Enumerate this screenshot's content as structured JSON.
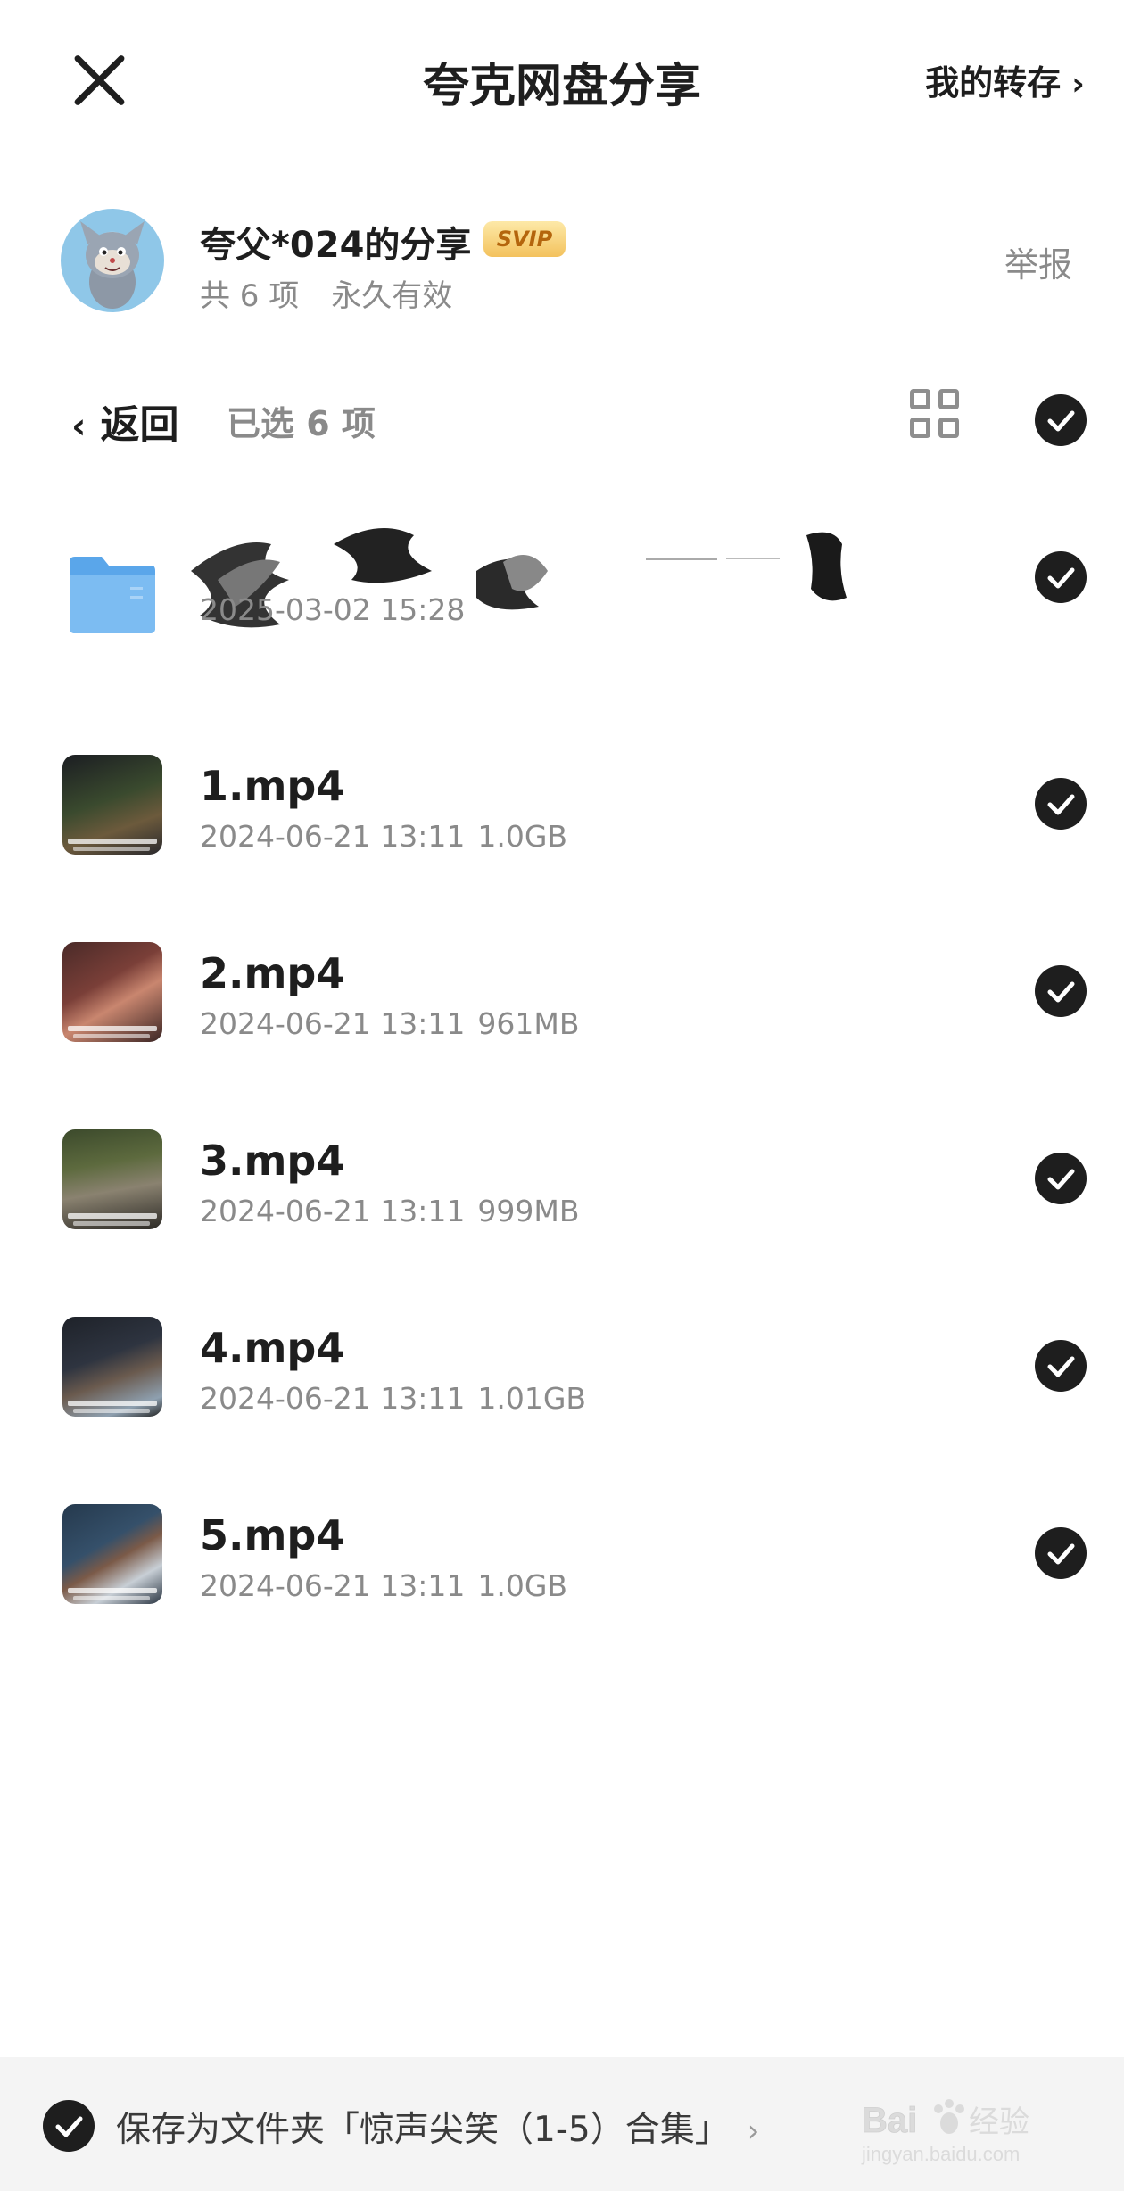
{
  "header": {
    "title": "夸克网盘分享",
    "my_transfer": "我的转存",
    "my_transfer_chevron": "›"
  },
  "sharer": {
    "name": "夸父*024的分享",
    "badge": "SVIP",
    "count": "共 6 项",
    "validity": "永久有效",
    "report": "举报"
  },
  "selection": {
    "back_chevron": "‹",
    "back_label": "返回",
    "selected_text": "已选 6 项",
    "all_checked": true
  },
  "files": [
    {
      "type": "folder",
      "name": "",
      "date": "2025-03-02 15:28",
      "size": "",
      "checked": true,
      "icon": "folder-icon"
    },
    {
      "type": "video",
      "name": "1.mp4",
      "date": "2024-06-21 13:11",
      "size": "1.0GB",
      "checked": true,
      "thumb_color": "#3a4a2e"
    },
    {
      "type": "video",
      "name": "2.mp4",
      "date": "2024-06-21 13:11",
      "size": "961MB",
      "checked": true,
      "thumb_color": "#7a3f38"
    },
    {
      "type": "video",
      "name": "3.mp4",
      "date": "2024-06-21 13:11",
      "size": "999MB",
      "checked": true,
      "thumb_color": "#5d6a3e"
    },
    {
      "type": "video",
      "name": "4.mp4",
      "date": "2024-06-21 13:11",
      "size": "1.01GB",
      "checked": true,
      "thumb_color": "#2e3440"
    },
    {
      "type": "video",
      "name": "5.mp4",
      "date": "2024-06-21 13:11",
      "size": "1.0GB",
      "checked": true,
      "thumb_color": "#35506a"
    }
  ],
  "bottom": {
    "save_label": "保存为文件夹「惊声尖笑（1-5）合集」",
    "chevron": "›",
    "checked": true
  },
  "watermark": {
    "brand": "Bai",
    "brand_suffix": "经验",
    "url": "jingyan.baidu.com"
  },
  "colors": {
    "text_primary": "#1e1e1e",
    "text_secondary": "#8a8a8a",
    "folder": "#6cb2ee",
    "svip_gold": "#f3c25d",
    "bottom_bar": "#f4f4f4"
  }
}
